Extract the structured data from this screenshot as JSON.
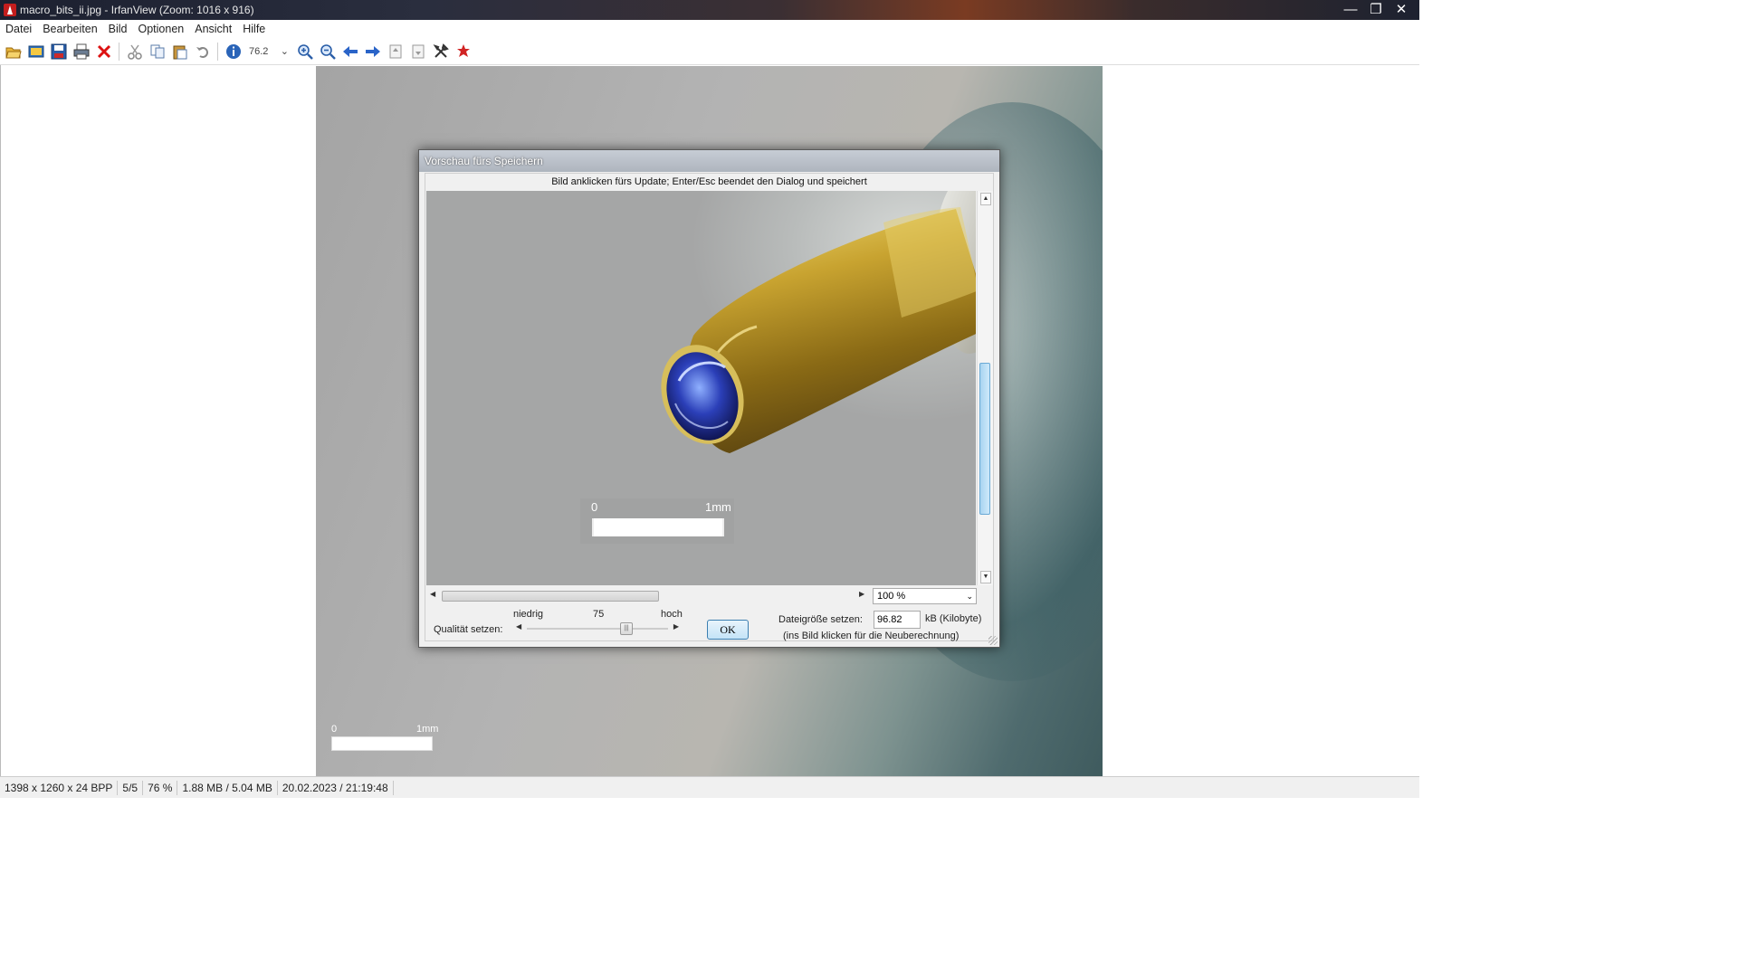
{
  "window": {
    "title": "macro_bits_ii.jpg - IrfanView (Zoom: 1016 x 916)",
    "controls": [
      "minimize",
      "maximize",
      "close"
    ]
  },
  "menu": [
    "Datei",
    "Bearbeiten",
    "Bild",
    "Optionen",
    "Ansicht",
    "Hilfe"
  ],
  "toolbar": {
    "zoom_value": "76.2",
    "buttons": [
      "open-icon",
      "slideshow-icon",
      "save-icon",
      "print-icon",
      "delete-icon",
      "cut-icon",
      "copy-icon",
      "paste-icon",
      "undo-icon",
      "info-icon",
      "zoom-in-icon",
      "zoom-out-icon",
      "previous-icon",
      "next-icon",
      "page-up-icon",
      "page-down-icon",
      "settings-icon",
      "exit-icon"
    ]
  },
  "background_image": {
    "scale_start": "0",
    "scale_end": "1mm"
  },
  "dialog": {
    "title": "Vorschau fürs Speichern",
    "hint": "Bild anklicken fürs Update; Enter/Esc beendet den Dialog und speichert",
    "preview_scale_start": "0",
    "preview_scale_end": "1mm",
    "zoom_select": "100 %",
    "quality_label": "Qualität setzen:",
    "quality_low": "niedrig",
    "quality_high": "hoch",
    "quality_value": "75",
    "ok_label": "OK",
    "filesize_label": "Dateigröße setzen:",
    "filesize_value": "96.82",
    "filesize_unit": "kB (Kilobyte)",
    "filesize_note": "(ins Bild klicken für die Neuberechnung)"
  },
  "status": {
    "dimensions": "1398 x 1260 x 24 BPP",
    "index": "5/5",
    "zoom": "76 %",
    "memory": "1.88 MB / 5.04 MB",
    "datetime": "20.02.2023 / 21:19:48"
  }
}
